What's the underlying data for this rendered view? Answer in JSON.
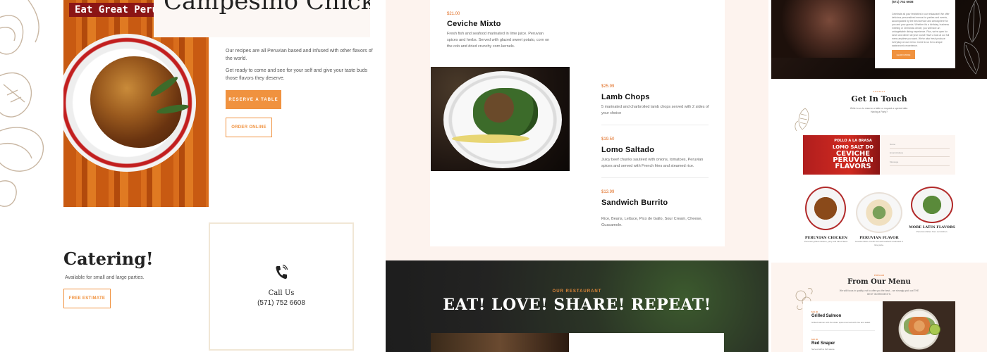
{
  "panel1": {
    "banner_text": "Eat Great Peruv",
    "title": "Campesino Chicken",
    "para1": "Our recipes are all Peruvian based and infused with other flavors of the world.",
    "para2": "Get ready to come and see for your self and give your taste buds those flavors they deserve.",
    "reserve_button": "RESERVE A TABLE",
    "order_button": "ORDER ONLINE",
    "catering_title": "Catering!",
    "catering_subtitle": "Available for small and large parties.",
    "estimate_button": "FREE ESTIMATE",
    "call_title": "Call Us",
    "call_number": "(571) 752 6608",
    "phone_icon": "phone-icon",
    "colors": {
      "accent": "#f0923f",
      "banner": "#8b1515"
    }
  },
  "panel2": {
    "items": [
      {
        "price": "$21.00",
        "name": "Ceviche Mixto",
        "desc": "Fresh fish and seafood marinated in lime juice. Peruvian spices and herbs. Served with glazed sweet potato, corn on the cob and dried crunchy corn kernels."
      },
      {
        "price": "$25.99",
        "name": "Lamb Chops",
        "desc": "5 marinated and charbroiled lamb chops served with 2 sides of your choice"
      },
      {
        "price": "$19.50",
        "name": "Lomo Saltado",
        "desc": "Juicy beef chunks sautéed with onions, tomatoes, Peruvian spices and served with French fries and steamed rice."
      },
      {
        "price": "$13.99",
        "name": "Sandwich Burrito",
        "desc": "Rice, Beans, Lettuce, Pico de Gallo, Sour Cream, Cheese, Guacamole."
      }
    ],
    "our_restaurant": "OUR RESTAURANT",
    "headline": "EAT! LOVE! SHARE! REPEAT!",
    "colors": {
      "price": "#e06a1e"
    }
  },
  "panel3": {
    "phone": "(571) 752 6608",
    "wine_text": "Celebrate all your festivities in our restaurant! We offer delicious personalized menus for parties and events, accompanied by the best service and atmosphere for you and your guests. Whether it's a birthday, business meeting or Christmas dinner, you will have an unforgettable dining experience. Plus, we're open for lunch and dinner all year round! Have a look at our full menu anytime you want. We've also fresh produce everyday on our menu. Come to us for a unique gastronomic experience.",
    "wine_button": "LEARN MORE",
    "contact_kicker": "CONTACT",
    "contact_title": "Get In Touch",
    "contact_sub": "Write to us to reserve a table or request a special date. Having a Party?",
    "sign_lines": [
      "POLLO A LA BRASA",
      "LOMO SALT DO",
      "CEVICHE",
      "PERUVIAN",
      "FLAVORS"
    ],
    "form_labels": [
      "Name",
      "Email Address",
      "Message"
    ],
    "dishes": [
      {
        "name": "PERUVIAN CHICKEN",
        "desc": "Peruvian grilled chicken, juicy and full of flavor."
      },
      {
        "name": "PERUVIAN FLAVOR",
        "desc": "Ceviche Mixto. Fresh fish and seafood marinated in lime juice."
      },
      {
        "name": "MORE LATIN FLAVORS",
        "desc": "Peruvian dishes from our kitchen."
      }
    ],
    "menu_kicker": "POPULAR",
    "menu_title": "From Our Menu",
    "menu_sub": "We will focus in quality, not to offer you the best... we strongly pick out THE BEST INGREDIENTS.",
    "menu_items": [
      {
        "price": "$23.00",
        "name": "Grilled Salmon",
        "desc": "Grilled salmon with Peruvian spices served with rice and salad."
      },
      {
        "price": "$26.00",
        "name": "Red Snaper",
        "desc": "Served with a fish sauce."
      }
    ]
  }
}
